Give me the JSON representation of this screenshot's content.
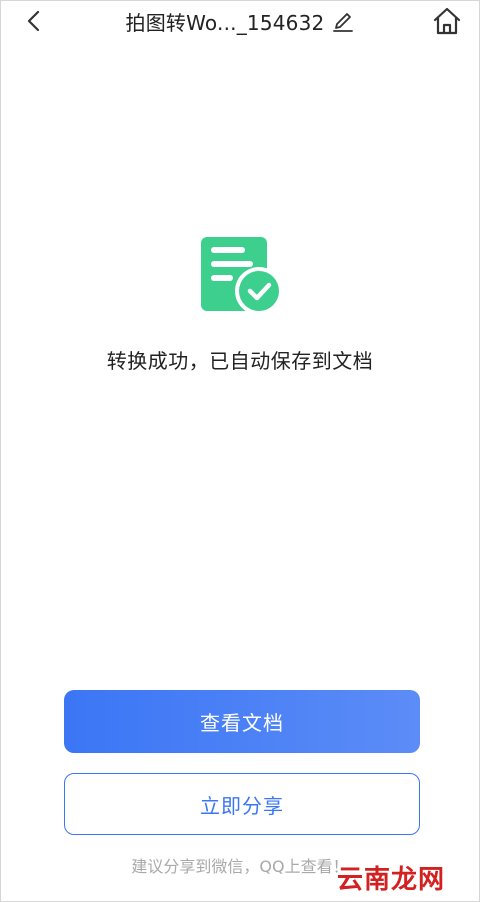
{
  "header": {
    "title": "拍图转Wo..._154632",
    "back_icon": "chevron-left-icon",
    "edit_icon": "pencil-icon",
    "home_icon": "home-icon"
  },
  "success": {
    "icon": "document-check-icon",
    "icon_color": "#3ccf8e",
    "message": "转换成功，已自动保存到文档"
  },
  "actions": {
    "view_document_label": "查看文档",
    "share_now_label": "立即分享",
    "primary_color": "#3b76f5"
  },
  "hint": {
    "text": "建议分享到微信，QQ上查看！"
  },
  "watermark": {
    "text": "云南龙网"
  }
}
